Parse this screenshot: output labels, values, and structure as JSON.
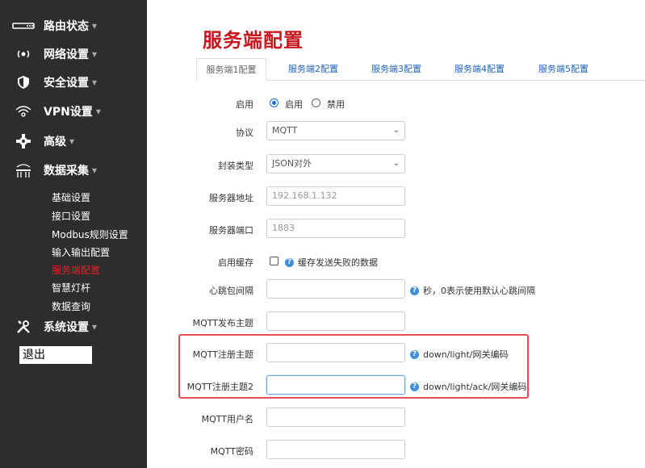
{
  "sidebar": {
    "top_items": [
      {
        "label": "路由状态",
        "icon": "router-icon"
      },
      {
        "label": "网络设置",
        "icon": "network-icon"
      },
      {
        "label": "安全设置",
        "icon": "shield-icon"
      },
      {
        "label": "VPN设置",
        "icon": "wifi-icon"
      },
      {
        "label": "高级",
        "icon": "gear-icon"
      },
      {
        "label": "数据采集",
        "icon": "data-collect-icon"
      }
    ],
    "sub_items": [
      "基础设置",
      "接口设置",
      "Modbus规则设置",
      "输入输出配置",
      "服务端配置",
      "智慧灯杆",
      "数据查询"
    ],
    "active_sub": "服务端配置",
    "system": {
      "label": "系统设置",
      "icon": "tools-icon"
    },
    "logout": "退出",
    "caret": "▾"
  },
  "page": {
    "title": "服务端配置",
    "tabs": [
      "服务端1配置",
      "服务端2配置",
      "服务端3配置",
      "服务端4配置",
      "服务端5配置"
    ]
  },
  "form": {
    "enable": {
      "label": "启用",
      "option_on": "启用",
      "option_off": "禁用",
      "selected": "启用"
    },
    "protocol": {
      "label": "协议",
      "value": "MQTT"
    },
    "encap": {
      "label": "封装类型",
      "value": "JSON对外"
    },
    "server_addr": {
      "label": "服务器地址",
      "value": "192.168.1.132"
    },
    "server_port": {
      "label": "服务器端口",
      "value": "1883"
    },
    "cache": {
      "label": "启用缓存",
      "help": "缓存发送失败的数据",
      "checked": false
    },
    "heartbeat": {
      "label": "心跳包间隔",
      "value": "",
      "help": "秒，0表示使用默认心跳间隔"
    },
    "pub_topic": {
      "label": "MQTT发布主题",
      "value": ""
    },
    "reg_topic": {
      "label": "MQTT注册主题",
      "value": "",
      "help": "down/light/网关编码"
    },
    "reg_topic2": {
      "label": "MQTT注册主题2",
      "value": "",
      "help": "down/light/ack/网关编码"
    },
    "username": {
      "label": "MQTT用户名",
      "value": ""
    },
    "password": {
      "label": "MQTT密码",
      "value": ""
    }
  },
  "colors": {
    "accent": "#c9171e",
    "sidebar_bg": "#2d2d2d",
    "link": "#2065c2",
    "highlight": "#e84b52"
  }
}
